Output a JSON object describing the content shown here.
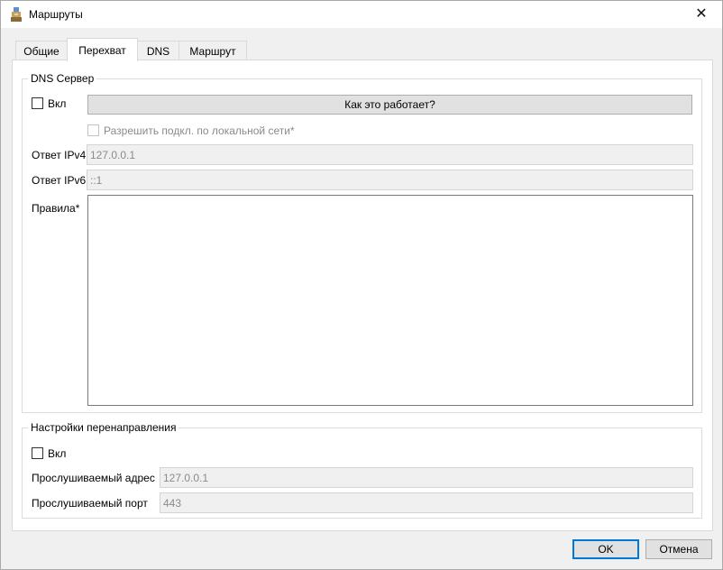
{
  "window": {
    "title": "Маршруты",
    "close_glyph": "✕"
  },
  "tabs": [
    {
      "label": "Общие",
      "active": false
    },
    {
      "label": "Перехват",
      "active": true
    },
    {
      "label": "DNS",
      "active": false
    },
    {
      "label": "Маршрут",
      "active": false
    }
  ],
  "dns_server": {
    "legend": "DNS Сервер",
    "enable_label": "Вкл",
    "enabled": false,
    "how_it_works_button": "Как это работает?",
    "allow_local_label": "Разрешить подкл. по локальной сети*",
    "allow_local_enabled": false,
    "ipv4_label": "Ответ IPv4",
    "ipv4_value": "127.0.0.1",
    "ipv6_label": "Ответ IPv6",
    "ipv6_value": "::1",
    "rules_label": "Правила*",
    "rules_value": ""
  },
  "redirect": {
    "legend": "Настройки перенаправления",
    "enable_label": "Вкл",
    "enabled": false,
    "listen_address_label": "Прослушиваемый адрес",
    "listen_address_value": "127.0.0.1",
    "listen_port_label": "Прослушиваемый порт",
    "listen_port_value": "443"
  },
  "footer": {
    "ok_label": "OK",
    "cancel_label": "Отмена"
  },
  "colors": {
    "accent": "#0078d7",
    "window_bg": "#f0f0f0",
    "page_bg": "#ffffff"
  },
  "icons": {
    "app": "app-icon",
    "close": "close-icon"
  }
}
